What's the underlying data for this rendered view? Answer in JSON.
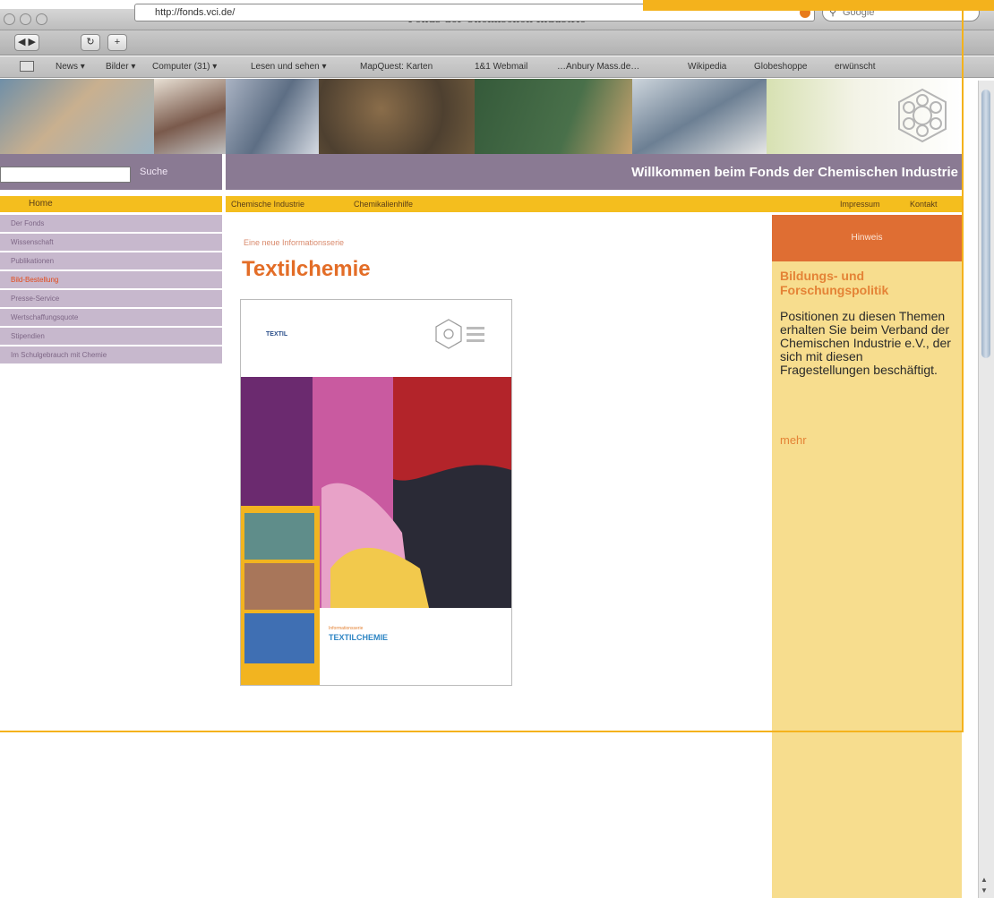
{
  "browser": {
    "window_title": "Fonds der Chemischen Industrie",
    "url": "http://fonds.vci.de/",
    "search_placeholder": "Google",
    "bookmarks": [
      "News ▾",
      "Bilder ▾",
      "Computer (31) ▾",
      "Lesen und sehen ▾",
      "MapQuest: Karten",
      "1&1 Webmail",
      "…Anbury Mass.de…",
      "Wikipedia",
      "Globeshoppe",
      "erwünscht"
    ]
  },
  "header": {
    "search_button": "Suche",
    "welcome": "Willkommen beim Fonds der Chemischen Industrie"
  },
  "nav": {
    "home": "Home",
    "primary": [
      "Chemische Industrie",
      "Chemikalienhilfe"
    ],
    "secondary": [
      "Impressum",
      "Kontakt"
    ]
  },
  "sidebar": {
    "items": [
      {
        "label": "Der Fonds"
      },
      {
        "label": "Wissenschaft"
      },
      {
        "label": "Publikationen"
      },
      {
        "label": "Bild-Bestellung"
      },
      {
        "label": "Presse-Service"
      },
      {
        "label": "Wertschaffungsquote"
      },
      {
        "label": "Stipendien"
      },
      {
        "label": "Im Schulgebrauch mit Chemie"
      }
    ]
  },
  "main": {
    "kicker": "Eine neue Informationsserie",
    "headline": "Textilchemie",
    "cover": {
      "brand": "TEXTIL",
      "series": "Informationsserie",
      "title": "TEXTILCHEMIE"
    }
  },
  "right": {
    "box_label": "Hinweis",
    "heading": "Bildungs- und Forschungspolitik",
    "body": "Positionen zu diesen Themen erhalten Sie beim Verband der Chemischen Industrie e.V., der sich mit diesen Fragestellungen beschäftigt.",
    "more": "mehr"
  },
  "colors": {
    "purple_bar": "#8a7a93",
    "yellow_nav": "#f4be1e",
    "accent_orange": "#e36d27",
    "right_panel": "#f7dd8e"
  }
}
